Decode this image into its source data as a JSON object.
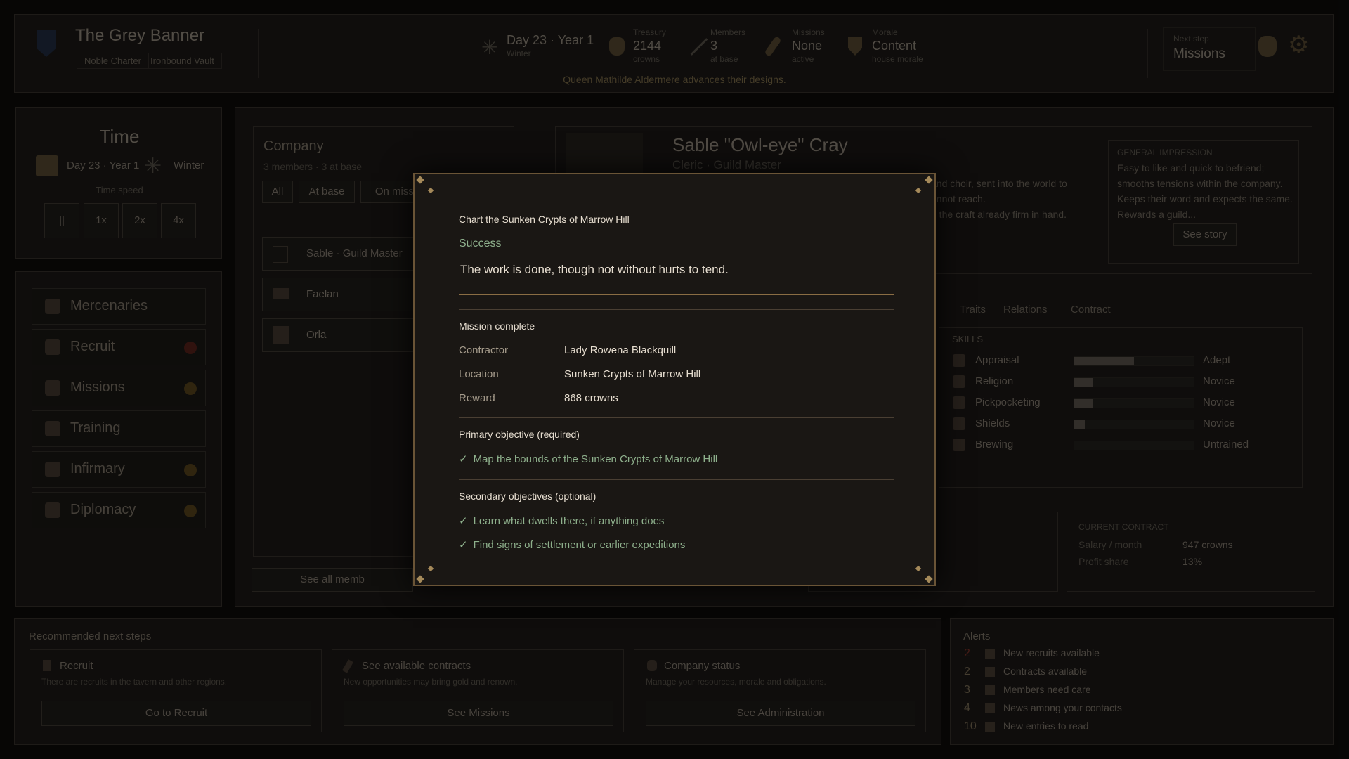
{
  "header": {
    "company_name": "The Grey Banner",
    "badges": [
      "Noble Charter",
      "Ironbound Vault"
    ],
    "date": {
      "main": "Day 23 · Year 1",
      "sub": "Winter"
    },
    "stats": [
      {
        "label": "Treasury",
        "value": "2144",
        "sub": "crowns",
        "icon": "coin-bag-icon"
      },
      {
        "label": "Members",
        "value": "3",
        "sub": "at base",
        "icon": "sword-icon"
      },
      {
        "label": "Missions",
        "value": "None",
        "sub": "active",
        "icon": "quill-icon"
      },
      {
        "label": "Morale",
        "value": "Content",
        "sub": "house morale",
        "icon": "shield-icon"
      }
    ],
    "next_step_label": "Next step",
    "next_step_value": "Missions",
    "announcement": "Queen Mathilde Aldermere advances their designs."
  },
  "time_panel": {
    "title": "Time",
    "date": "Day 23 · Year 1",
    "season": "Winter",
    "speed_label": "Time speed",
    "speeds": [
      "||",
      "1x",
      "2x",
      "4x"
    ]
  },
  "nav": [
    {
      "label": "Mercenaries",
      "icon": "sword-icon",
      "badge": false
    },
    {
      "label": "Recruit",
      "icon": "helmet-icon",
      "badge": true,
      "badge_color": "#4a1c16"
    },
    {
      "label": "Missions",
      "icon": "quill-icon",
      "badge": true,
      "badge_color": "#4a3a18"
    },
    {
      "label": "Training",
      "icon": "training-icon",
      "badge": false
    },
    {
      "label": "Infirmary",
      "icon": "infirmary-icon",
      "badge": true,
      "badge_color": "#4a3a18"
    },
    {
      "label": "Diplomacy",
      "icon": "scroll-icon",
      "badge": true,
      "badge_color": "#4a3a18"
    }
  ],
  "company": {
    "title": "Company",
    "subtitle": "3 members · 3 at base",
    "filters": [
      "All",
      "At base",
      "On missi"
    ],
    "members": [
      "Sable · Guild Master",
      "Faelan",
      "Orla"
    ],
    "see_all": "See all memb"
  },
  "character": {
    "name": "Sable \"Owl-eye\" Cray",
    "role": "Cleric · Guild Master",
    "bio_lines": [
      "and choir, sent into the world to",
      "annot reach.",
      "d the craft already firm in hand."
    ],
    "impression_title": "GENERAL IMPRESSION",
    "impression_text": "Easy to like and quick to befriend; smooths tensions within the company. Keeps their word and expects the same. Rewards a guild...",
    "see_story": "See story",
    "tabs": [
      "Traits",
      "Relations",
      "Contract"
    ],
    "skills_title": "SKILLS",
    "skills": [
      {
        "name": "Appraisal",
        "level": "Adept",
        "fill": 0.5,
        "icon": "scales-icon"
      },
      {
        "name": "Religion",
        "level": "Novice",
        "fill": 0.15,
        "icon": "book-icon"
      },
      {
        "name": "Pickpocketing",
        "level": "Novice",
        "fill": 0.15,
        "icon": "pouch-icon"
      },
      {
        "name": "Shields",
        "level": "Novice",
        "fill": 0.09,
        "icon": "round-shield-icon"
      },
      {
        "name": "Brewing",
        "level": "Untrained",
        "fill": 0,
        "icon": "mug-icon"
      }
    ],
    "contract_title": "CURRENT CONTRACT",
    "salary_label": "Salary / month",
    "salary_value": "947 crowns",
    "profit_label": "Profit share",
    "profit_value": "13%"
  },
  "recommended": {
    "title": "Recommended next steps",
    "cards": [
      {
        "title": "Recruit",
        "desc": "There are recruits in the tavern and other regions.",
        "button": "Go to Recruit",
        "icon": "helmet-icon"
      },
      {
        "title": "See available contracts",
        "desc": "New opportunities may bring gold and renown.",
        "button": "See Missions",
        "icon": "quill-icon"
      },
      {
        "title": "Company status",
        "desc": "Manage your resources, morale and obligations.",
        "button": "See Administration",
        "icon": "coin-bag-icon"
      }
    ]
  },
  "alerts": {
    "title": "Alerts",
    "items": [
      {
        "count": "2",
        "text": "New recruits available",
        "red": true
      },
      {
        "count": "2",
        "text": "Contracts available",
        "red": false
      },
      {
        "count": "3",
        "text": "Members need care",
        "red": false
      },
      {
        "count": "4",
        "text": "News among your contacts",
        "red": false
      },
      {
        "count": "10",
        "text": "New entries to read",
        "red": false
      }
    ]
  },
  "modal": {
    "mission_name": "Chart the Sunken Crypts of Marrow Hill",
    "result": "Success",
    "flavor": "The work is done, though not without hurts to tend.",
    "section_title": "Mission complete",
    "details": [
      {
        "label": "Contractor",
        "value": "Lady Rowena Blackquill"
      },
      {
        "label": "Location",
        "value": "Sunken Crypts of Marrow Hill"
      },
      {
        "label": "Reward",
        "value": "868 crowns"
      }
    ],
    "primary_title": "Primary objective (required)",
    "primary": [
      "Map the bounds of the Sunken Crypts of Marrow Hill"
    ],
    "secondary_title": "Secondary objectives (optional)",
    "secondary": [
      "Learn what dwells there, if anything does",
      "Find signs of settlement or earlier expeditions"
    ],
    "check_glyph": "✓",
    "accent_color": "#8eb08c"
  }
}
